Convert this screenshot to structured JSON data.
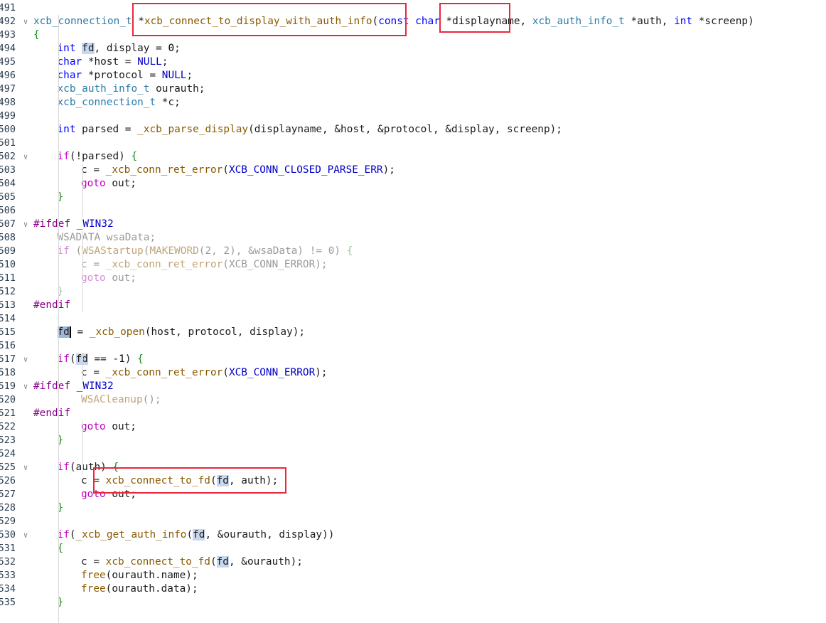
{
  "lines": [
    {
      "n": "491",
      "fold": "",
      "indent": 0,
      "dim": false,
      "toks": []
    },
    {
      "n": "492",
      "fold": "v",
      "indent": 0,
      "dim": false,
      "toks": [
        [
          "ty",
          "xcb_connection_t"
        ],
        [
          "op",
          " *"
        ],
        [
          "fn",
          "xcb_connect_to_display_with_auth_info"
        ],
        [
          "op",
          "("
        ],
        [
          "kw",
          "const"
        ],
        [
          "op",
          " "
        ],
        [
          "kw",
          "char"
        ],
        [
          "op",
          " *displayname, "
        ],
        [
          "ty",
          "xcb_auth_info_t"
        ],
        [
          "op",
          " *auth, "
        ],
        [
          "kw",
          "int"
        ],
        [
          "op",
          " *screenp)"
        ]
      ]
    },
    {
      "n": "493",
      "fold": "",
      "indent": 0,
      "dim": false,
      "toks": [
        [
          "br",
          "{"
        ]
      ]
    },
    {
      "n": "494",
      "fold": "",
      "indent": 1,
      "dim": false,
      "toks": [
        [
          "kw",
          "int"
        ],
        [
          "op",
          " "
        ],
        [
          "hl",
          "fd"
        ],
        [
          "op",
          ", display = "
        ],
        [
          "num",
          "0"
        ],
        [
          "op",
          ";"
        ]
      ]
    },
    {
      "n": "495",
      "fold": "",
      "indent": 1,
      "dim": false,
      "toks": [
        [
          "kw",
          "char"
        ],
        [
          "op",
          " *host = "
        ],
        [
          "mac",
          "NULL"
        ],
        [
          "op",
          ";"
        ]
      ]
    },
    {
      "n": "496",
      "fold": "",
      "indent": 1,
      "dim": false,
      "toks": [
        [
          "kw",
          "char"
        ],
        [
          "op",
          " *protocol = "
        ],
        [
          "mac",
          "NULL"
        ],
        [
          "op",
          ";"
        ]
      ]
    },
    {
      "n": "497",
      "fold": "",
      "indent": 1,
      "dim": false,
      "toks": [
        [
          "ty",
          "xcb_auth_info_t"
        ],
        [
          "op",
          " ourauth;"
        ]
      ]
    },
    {
      "n": "498",
      "fold": "",
      "indent": 1,
      "dim": false,
      "toks": [
        [
          "ty",
          "xcb_connection_t"
        ],
        [
          "op",
          " *c;"
        ]
      ]
    },
    {
      "n": "499",
      "fold": "",
      "indent": 0,
      "dim": false,
      "toks": []
    },
    {
      "n": "500",
      "fold": "",
      "indent": 1,
      "dim": false,
      "toks": [
        [
          "kw",
          "int"
        ],
        [
          "op",
          " parsed = "
        ],
        [
          "fn",
          "_xcb_parse_display"
        ],
        [
          "op",
          "(displayname, &host, &protocol, &display, screenp);"
        ]
      ]
    },
    {
      "n": "501",
      "fold": "",
      "indent": 0,
      "dim": false,
      "toks": []
    },
    {
      "n": "502",
      "fold": "v",
      "indent": 1,
      "dim": false,
      "toks": [
        [
          "cf",
          "if"
        ],
        [
          "op",
          "(!parsed) "
        ],
        [
          "br",
          "{"
        ]
      ]
    },
    {
      "n": "503",
      "fold": "",
      "indent": 2,
      "dim": false,
      "toks": [
        [
          "op",
          "c = "
        ],
        [
          "fn",
          "_xcb_conn_ret_error"
        ],
        [
          "op",
          "("
        ],
        [
          "mac",
          "XCB_CONN_CLOSED_PARSE_ERR"
        ],
        [
          "op",
          ");"
        ]
      ]
    },
    {
      "n": "504",
      "fold": "",
      "indent": 2,
      "dim": false,
      "toks": [
        [
          "cf",
          "goto"
        ],
        [
          "op",
          " out;"
        ]
      ]
    },
    {
      "n": "505",
      "fold": "",
      "indent": 1,
      "dim": false,
      "toks": [
        [
          "br",
          "}"
        ]
      ]
    },
    {
      "n": "506",
      "fold": "",
      "indent": 0,
      "dim": false,
      "toks": []
    },
    {
      "n": "507",
      "fold": "v",
      "indent": 0,
      "dim": false,
      "toks": [
        [
          "pre",
          "#ifdef"
        ],
        [
          "op",
          " "
        ],
        [
          "mac",
          "_WIN32"
        ]
      ]
    },
    {
      "n": "508",
      "fold": "",
      "indent": 1,
      "dim": true,
      "toks": [
        [
          "dim",
          "WSADATA wsaData;"
        ]
      ]
    },
    {
      "n": "509",
      "fold": "",
      "indent": 1,
      "dim": true,
      "toks": [
        [
          "dimcf",
          "if"
        ],
        [
          "dim",
          " ("
        ],
        [
          "dimfn",
          "WSAStartup"
        ],
        [
          "dim",
          "("
        ],
        [
          "dimfn",
          "MAKEWORD"
        ],
        [
          "dim",
          "(2, 2), &wsaData) != 0) "
        ],
        [
          "dimbr",
          "{"
        ]
      ]
    },
    {
      "n": "510",
      "fold": "",
      "indent": 2,
      "dim": true,
      "toks": [
        [
          "dim",
          "c = "
        ],
        [
          "dimfn",
          "_xcb_conn_ret_error"
        ],
        [
          "dim",
          "(XCB_CONN_ERROR);"
        ]
      ]
    },
    {
      "n": "511",
      "fold": "",
      "indent": 2,
      "dim": true,
      "toks": [
        [
          "dimcf",
          "goto"
        ],
        [
          "dim",
          " out;"
        ]
      ]
    },
    {
      "n": "512",
      "fold": "",
      "indent": 1,
      "dim": true,
      "toks": [
        [
          "dimbr",
          "}"
        ]
      ]
    },
    {
      "n": "513",
      "fold": "",
      "indent": 0,
      "dim": false,
      "toks": [
        [
          "pre",
          "#endif"
        ]
      ]
    },
    {
      "n": "514",
      "fold": "",
      "indent": 0,
      "dim": false,
      "toks": []
    },
    {
      "n": "515",
      "fold": "",
      "indent": 1,
      "dim": false,
      "toks": [
        [
          "hlcur",
          "fd"
        ],
        [
          "op",
          " = "
        ],
        [
          "fn",
          "_xcb_open"
        ],
        [
          "op",
          "(host, protocol, display);"
        ]
      ]
    },
    {
      "n": "516",
      "fold": "",
      "indent": 0,
      "dim": false,
      "toks": []
    },
    {
      "n": "517",
      "fold": "v",
      "indent": 1,
      "dim": false,
      "toks": [
        [
          "cf",
          "if"
        ],
        [
          "op",
          "("
        ],
        [
          "hl",
          "fd"
        ],
        [
          "op",
          " == -"
        ],
        [
          "num",
          "1"
        ],
        [
          "op",
          ") "
        ],
        [
          "br",
          "{"
        ]
      ]
    },
    {
      "n": "518",
      "fold": "",
      "indent": 2,
      "dim": false,
      "toks": [
        [
          "op",
          "c = "
        ],
        [
          "fn",
          "_xcb_conn_ret_error"
        ],
        [
          "op",
          "("
        ],
        [
          "mac",
          "XCB_CONN_ERROR"
        ],
        [
          "op",
          ");"
        ]
      ]
    },
    {
      "n": "519",
      "fold": "v",
      "indent": 0,
      "dim": false,
      "toks": [
        [
          "pre",
          "#ifdef"
        ],
        [
          "op",
          " "
        ],
        [
          "mac",
          "_WIN32"
        ]
      ]
    },
    {
      "n": "520",
      "fold": "",
      "indent": 2,
      "dim": true,
      "toks": [
        [
          "dimfn",
          "WSACleanup"
        ],
        [
          "dim",
          "();"
        ]
      ]
    },
    {
      "n": "521",
      "fold": "",
      "indent": 0,
      "dim": false,
      "toks": [
        [
          "pre",
          "#endif"
        ]
      ]
    },
    {
      "n": "522",
      "fold": "",
      "indent": 2,
      "dim": false,
      "toks": [
        [
          "cf",
          "goto"
        ],
        [
          "op",
          " out;"
        ]
      ]
    },
    {
      "n": "523",
      "fold": "",
      "indent": 1,
      "dim": false,
      "toks": [
        [
          "br",
          "}"
        ]
      ]
    },
    {
      "n": "524",
      "fold": "",
      "indent": 0,
      "dim": false,
      "toks": []
    },
    {
      "n": "525",
      "fold": "v",
      "indent": 1,
      "dim": false,
      "toks": [
        [
          "cf",
          "if"
        ],
        [
          "op",
          "(auth) "
        ],
        [
          "br",
          "{"
        ]
      ]
    },
    {
      "n": "526",
      "fold": "",
      "indent": 2,
      "dim": false,
      "toks": [
        [
          "op",
          "c = "
        ],
        [
          "fn",
          "xcb_connect_to_fd"
        ],
        [
          "op",
          "("
        ],
        [
          "hl",
          "fd"
        ],
        [
          "op",
          ", auth);"
        ]
      ]
    },
    {
      "n": "527",
      "fold": "",
      "indent": 2,
      "dim": false,
      "toks": [
        [
          "cf",
          "goto"
        ],
        [
          "op",
          " out;"
        ]
      ]
    },
    {
      "n": "528",
      "fold": "",
      "indent": 1,
      "dim": false,
      "toks": [
        [
          "br",
          "}"
        ]
      ]
    },
    {
      "n": "529",
      "fold": "",
      "indent": 0,
      "dim": false,
      "toks": []
    },
    {
      "n": "530",
      "fold": "v",
      "indent": 1,
      "dim": false,
      "toks": [
        [
          "cf",
          "if"
        ],
        [
          "op",
          "("
        ],
        [
          "fn",
          "_xcb_get_auth_info"
        ],
        [
          "op",
          "("
        ],
        [
          "hl",
          "fd"
        ],
        [
          "op",
          ", &ourauth, display))"
        ]
      ]
    },
    {
      "n": "531",
      "fold": "",
      "indent": 1,
      "dim": false,
      "toks": [
        [
          "br",
          "{"
        ]
      ]
    },
    {
      "n": "532",
      "fold": "",
      "indent": 2,
      "dim": false,
      "toks": [
        [
          "op",
          "c = "
        ],
        [
          "fn",
          "xcb_connect_to_fd"
        ],
        [
          "op",
          "("
        ],
        [
          "hl",
          "fd"
        ],
        [
          "op",
          ", &ourauth);"
        ]
      ]
    },
    {
      "n": "533",
      "fold": "",
      "indent": 2,
      "dim": false,
      "toks": [
        [
          "fn",
          "free"
        ],
        [
          "op",
          "(ourauth.name);"
        ]
      ]
    },
    {
      "n": "534",
      "fold": "",
      "indent": 2,
      "dim": false,
      "toks": [
        [
          "fn",
          "free"
        ],
        [
          "op",
          "(ourauth.data);"
        ]
      ]
    },
    {
      "n": "535",
      "fold": "",
      "indent": 1,
      "dim": false,
      "toks": [
        [
          "br",
          "}"
        ]
      ]
    }
  ],
  "colors": {
    "highlight_box": "#e8283c",
    "line_number": "#2c3e50",
    "selection_highlight": "#c7d8ee"
  }
}
